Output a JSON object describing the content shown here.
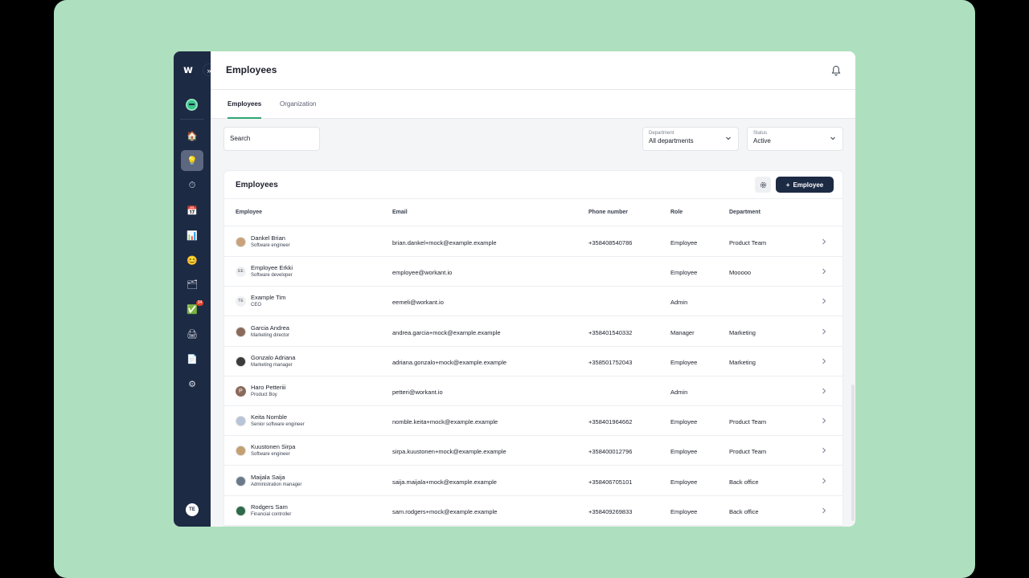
{
  "sidebar": {
    "logo": "w",
    "collapse_glyph": "»",
    "nav": [
      {
        "icon": "house-icon",
        "glyph": "🏠"
      },
      {
        "icon": "lightbulb-icon",
        "glyph": "💡"
      },
      {
        "icon": "stopwatch-icon",
        "glyph": "⏱"
      },
      {
        "icon": "calendar-icon",
        "glyph": "📅"
      },
      {
        "icon": "bar-chart-icon",
        "glyph": "📊"
      },
      {
        "icon": "smiley-icon",
        "glyph": "😊"
      },
      {
        "icon": "documents-icon",
        "glyph": "🗂"
      },
      {
        "icon": "checkmark-icon",
        "glyph": "✅",
        "badge": "34"
      },
      {
        "icon": "printer-icon",
        "glyph": "🖨"
      },
      {
        "icon": "file-icon",
        "glyph": "📄"
      },
      {
        "icon": "gear-icon",
        "glyph": "⚙"
      }
    ],
    "user_initials": "TE"
  },
  "header": {
    "title": "Employees"
  },
  "tabs": [
    {
      "label": "Employees"
    },
    {
      "label": "Organization"
    }
  ],
  "filters": {
    "search": {
      "placeholder": "Search",
      "value": ""
    },
    "department": {
      "label": "Department",
      "value": "All departments"
    },
    "status": {
      "label": "Status",
      "value": "Active"
    }
  },
  "card": {
    "title": "Employees",
    "add_button": "Employee",
    "add_glyph": "+",
    "columns": [
      "Employee",
      "Email",
      "Phone number",
      "Role",
      "Department"
    ]
  },
  "employees": [
    {
      "name": "Dankel Brian",
      "title": "Software engineer",
      "email": "brian.dankel+mock@example.example",
      "phone": "+358408540786",
      "role": "Employee",
      "department": "Product Team",
      "avatar": "photo"
    },
    {
      "name": "Employee Erkki",
      "title": "Software developer",
      "email": "employee@workant.io",
      "phone": "",
      "role": "Employee",
      "department": "Mooooo",
      "avatar": "EE"
    },
    {
      "name": "Example Tim",
      "title": "CEO",
      "email": "eemeli@workant.io",
      "phone": "",
      "role": "Admin",
      "department": "",
      "avatar": "TE"
    },
    {
      "name": "Garcia Andrea",
      "title": "Marketing director",
      "email": "andrea.garcia+mock@example.example",
      "phone": "+358401540332",
      "role": "Manager",
      "department": "Marketing",
      "avatar": "photo"
    },
    {
      "name": "Gonzalo Adriana",
      "title": "Marketing manager",
      "email": "adriana.gonzalo+mock@example.example",
      "phone": "+358501752043",
      "role": "Employee",
      "department": "Marketing",
      "avatar": "photo"
    },
    {
      "name": "Haro Petteriii",
      "title": "Product Boy",
      "email": "petteri@workant.io",
      "phone": "",
      "role": "Admin",
      "department": "",
      "avatar": "P"
    },
    {
      "name": "Keita Nomble",
      "title": "Senior software engineer",
      "email": "nomble.keita+mock@example.example",
      "phone": "+358401964662",
      "role": "Employee",
      "department": "Product Team",
      "avatar": "photo"
    },
    {
      "name": "Kuustonen Sirpa",
      "title": "Software engineer",
      "email": "sirpa.kuustonen+mock@example.example",
      "phone": "+358400012796",
      "role": "Employee",
      "department": "Product Team",
      "avatar": "photo"
    },
    {
      "name": "Maijala Saija",
      "title": "Administration manager",
      "email": "saija.maijala+mock@example.example",
      "phone": "+358406705101",
      "role": "Employee",
      "department": "Back office",
      "avatar": "photo"
    },
    {
      "name": "Rodgers Sam",
      "title": "Financial controller",
      "email": "sam.rodgers+mock@example.example",
      "phone": "+358409269833",
      "role": "Employee",
      "department": "Back office",
      "avatar": "photo"
    }
  ]
}
